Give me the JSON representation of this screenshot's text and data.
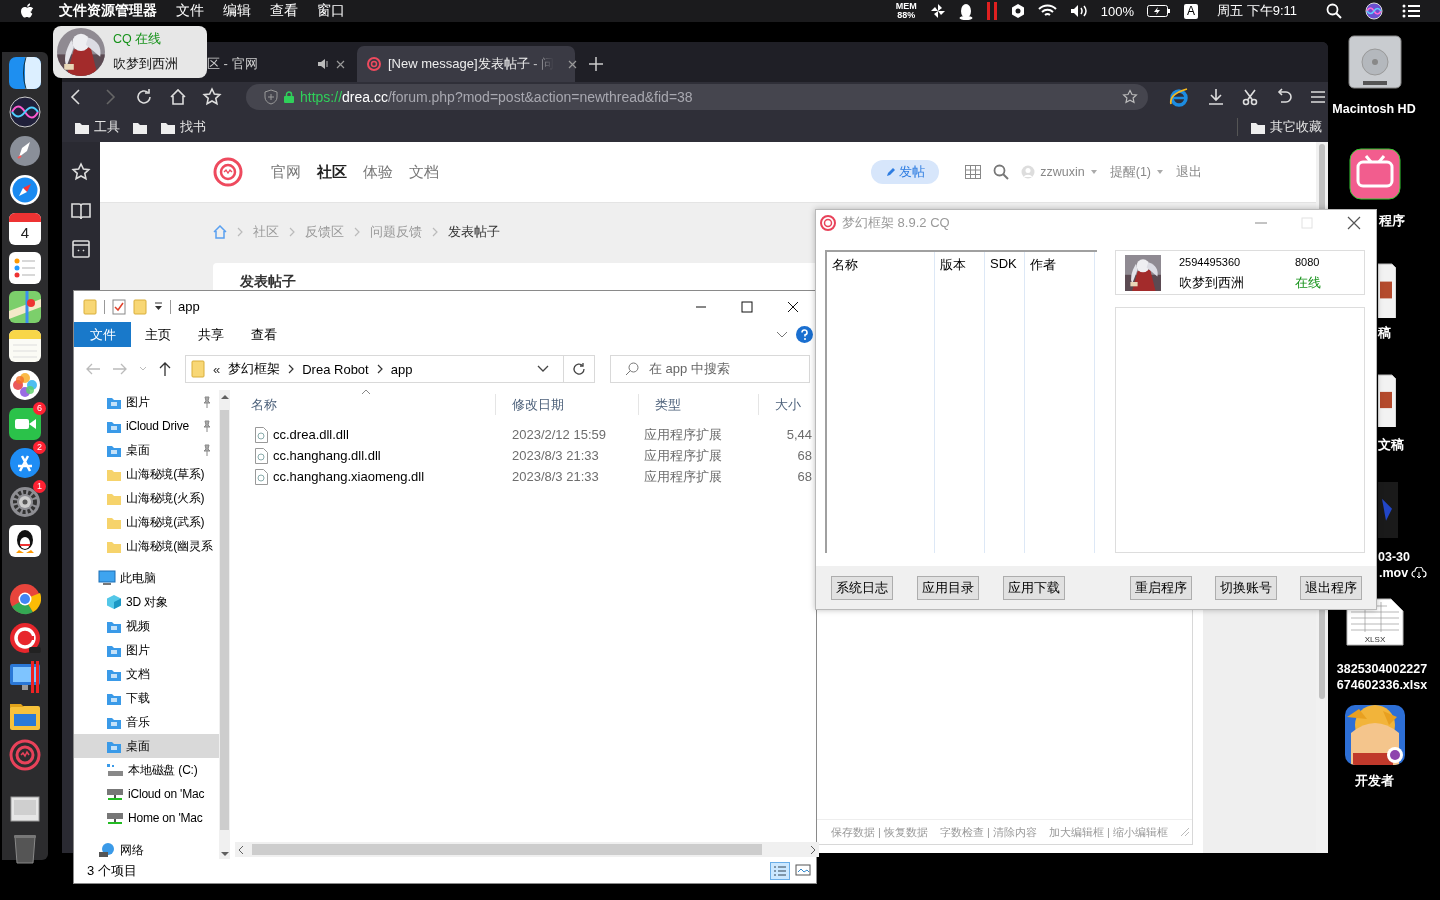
{
  "menubar": {
    "app_name": "文件资源管理器",
    "menus": [
      "文件",
      "编辑",
      "查看",
      "窗口"
    ],
    "status": {
      "mem_label": "MEM",
      "mem_value": "88%",
      "battery_percent": "100%",
      "input_source": "A",
      "clock": "周五 下午9:11"
    }
  },
  "notification": {
    "title": "CQ 在线",
    "body": "吹梦到西洲"
  },
  "dock": {
    "items": [
      {
        "kind": "finder"
      },
      {
        "kind": "siri"
      },
      {
        "kind": "launchpad"
      },
      {
        "kind": "safari"
      },
      {
        "kind": "calendar",
        "text": "4"
      },
      {
        "kind": "reminders"
      },
      {
        "kind": "maps"
      },
      {
        "kind": "notes"
      },
      {
        "kind": "photos"
      },
      {
        "kind": "facetime",
        "badge": "6"
      },
      {
        "kind": "appstore",
        "badge": "2"
      },
      {
        "kind": "settings",
        "badge": "1"
      },
      {
        "kind": "qq"
      },
      {
        "kind": "chrome"
      },
      {
        "kind": "pro"
      },
      {
        "kind": "windows"
      },
      {
        "kind": "explorer"
      },
      {
        "kind": "drea"
      },
      {
        "kind": "preview"
      },
      {
        "kind": "trash"
      }
    ]
  },
  "desktop": {
    "icons": [
      {
        "kind": "drive",
        "lines": [
          "Macintosh HD"
        ]
      },
      {
        "kind": "tv_app",
        "lines": [
          "程序"
        ]
      },
      {
        "kind": "document",
        "lines": [
          "稿"
        ]
      },
      {
        "kind": "document",
        "lines": [
          "文稿"
        ]
      },
      {
        "kind": "video",
        "lines": [
          "03-30",
          ".mov"
        ],
        "in_cloud": true
      },
      {
        "kind": "spreadsheet",
        "icon_text": "XLSX",
        "lines": [
          "3825304002227",
          "674602336.xlsx"
        ]
      },
      {
        "kind": "picture",
        "lines": [
          "开发者"
        ]
      }
    ]
  },
  "browser": {
    "tabs": [
      {
        "title": "区 - 官网",
        "selected": false,
        "audio": true
      },
      {
        "title": "[New message]发表帖子 - 问",
        "selected": true,
        "audio": false
      }
    ],
    "address": {
      "scheme": "https://",
      "host": "drea.cc",
      "path": "/forum.php?mod=post&action=newthread&fid=38"
    },
    "bookmarks": [
      "工具",
      "找书"
    ],
    "other_bookmarks": "其它收藏",
    "page": {
      "nav": [
        {
          "label": "官网",
          "selected": false
        },
        {
          "label": "社区",
          "selected": true
        },
        {
          "label": "体验",
          "selected": false
        },
        {
          "label": "文档",
          "selected": false
        }
      ],
      "post_button": "发帖",
      "user": "zzwuxin",
      "reminders": "提醒(1)",
      "logout": "退出",
      "breadcrumb": [
        "社区",
        "反馈区",
        "问题反馈",
        "发表帖子"
      ],
      "card_title": "发表帖子",
      "editor_links": [
        "保存数据 | 恢复数据",
        "字数检查 | 清除内容",
        "加大编辑框 | 缩小编辑框"
      ]
    }
  },
  "explorer": {
    "title": "app",
    "ribbon_tabs": [
      {
        "label": "文件",
        "selected": true
      },
      {
        "label": "主页",
        "selected": false
      },
      {
        "label": "共享",
        "selected": false
      },
      {
        "label": "查看",
        "selected": false
      }
    ],
    "overflow_mark": "«",
    "path": [
      "梦幻框架",
      "Drea Robot",
      "app"
    ],
    "search_placeholder": "在 app 中搜索",
    "quick_access": [
      {
        "label": "图片",
        "kind": "pictures",
        "pinned": true,
        "selected": false
      },
      {
        "label": "iCloud Drive",
        "kind": "icloud",
        "pinned": true,
        "selected": false
      },
      {
        "label": "桌面",
        "kind": "desktop",
        "pinned": true,
        "selected": false
      },
      {
        "label": "山海秘境(草系)",
        "kind": "folder",
        "pinned": false,
        "selected": false
      },
      {
        "label": "山海秘境(火系)",
        "kind": "folder",
        "pinned": false,
        "selected": false
      },
      {
        "label": "山海秘境(武系)",
        "kind": "folder",
        "pinned": false,
        "selected": false
      },
      {
        "label": "山海秘境(幽灵系",
        "kind": "folder",
        "pinned": false,
        "selected": false
      }
    ],
    "tree": [
      {
        "label": "此电脑",
        "kind": "pc",
        "selected": false,
        "children": [
          {
            "label": "3D 对象",
            "kind": "objects",
            "selected": false
          },
          {
            "label": "视频",
            "kind": "videos",
            "selected": false
          },
          {
            "label": "图片",
            "kind": "pictures",
            "selected": false
          },
          {
            "label": "文档",
            "kind": "documents",
            "selected": false
          },
          {
            "label": "下载",
            "kind": "downloads",
            "selected": false
          },
          {
            "label": "音乐",
            "kind": "music",
            "selected": false
          },
          {
            "label": "桌面",
            "kind": "desktop",
            "selected": true
          },
          {
            "label": "本地磁盘 (C:)",
            "kind": "disk",
            "selected": false
          },
          {
            "label": "iCloud on 'Mac",
            "kind": "netdrive",
            "selected": false
          },
          {
            "label": "Home on 'Mac",
            "kind": "netdrive",
            "selected": false
          }
        ]
      },
      {
        "label": "网络",
        "kind": "network",
        "selected": false
      }
    ],
    "columns": [
      {
        "label": "名称",
        "sorted": true
      },
      {
        "label": "修改日期",
        "sorted": false
      },
      {
        "label": "类型",
        "sorted": false
      },
      {
        "label": "大小",
        "sorted": false
      }
    ],
    "files": [
      {
        "name": "cc.drea.dll.dll",
        "modified": "2023/2/12 15:59",
        "type": "应用程序扩展",
        "size": "5,44",
        "selected": false
      },
      {
        "name": "cc.hanghang.dll.dll",
        "modified": "2023/8/3 21:33",
        "type": "应用程序扩展",
        "size": "68",
        "selected": false
      },
      {
        "name": "cc.hanghang.xiaomeng.dll",
        "modified": "2023/8/3 21:33",
        "type": "应用程序扩展",
        "size": "68",
        "selected": false
      }
    ],
    "status": "3 个项目"
  },
  "cq": {
    "title": "梦幻框架 8.9.2 CQ",
    "columns": [
      "名称",
      "版本",
      "SDK",
      "作者"
    ],
    "account": {
      "qq": "2594495360",
      "port": "8080",
      "nickname": "吹梦到西洲",
      "status": "在线"
    },
    "buttons_left": [
      "系统日志",
      "应用目录",
      "应用下载"
    ],
    "buttons_right": [
      "重启程序",
      "切换账号",
      "退出程序"
    ]
  }
}
